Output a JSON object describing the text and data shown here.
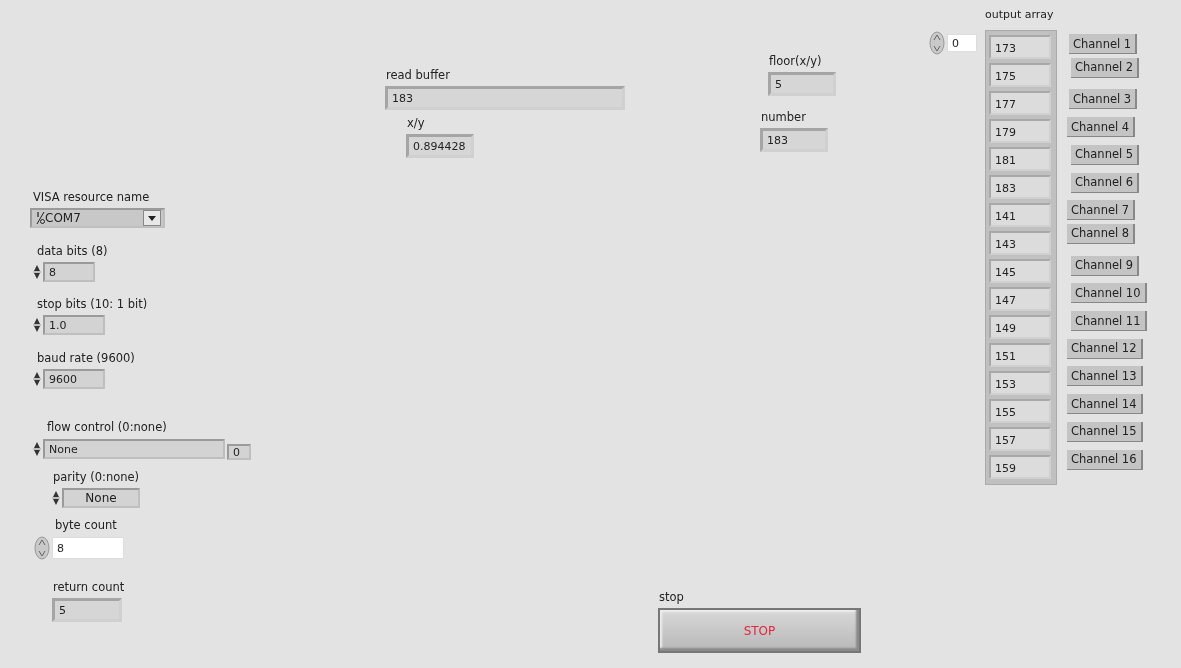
{
  "controls": [
    {
      "kind": "visa",
      "label": "VISA resource name",
      "value": "COM7"
    },
    {
      "kind": "numeric",
      "label": "data bits (8)",
      "value": "8"
    },
    {
      "kind": "numeric",
      "label": "stop bits (10: 1 bit)",
      "value": "1.0"
    },
    {
      "kind": "numeric",
      "label": "baud rate (9600)",
      "value": "9600"
    },
    {
      "kind": "enum",
      "label": "flow control (0:none)",
      "value": "None",
      "index": "0"
    },
    {
      "kind": "ring",
      "label": "parity (0:none)",
      "value": "None"
    },
    {
      "kind": "input",
      "label": "byte count",
      "value": "8"
    },
    {
      "kind": "indicator",
      "label": "return count",
      "value": "5"
    },
    {
      "kind": "indicator",
      "label": "read buffer",
      "value": "183"
    },
    {
      "kind": "indicator",
      "label": "x/y",
      "value": "0.894428"
    },
    {
      "kind": "indicator",
      "label": "floor(x/y)",
      "value": "5"
    },
    {
      "kind": "indicator",
      "label": "number",
      "value": "183"
    },
    {
      "kind": "button",
      "label": "stop",
      "value": "STOP"
    }
  ],
  "output_array": {
    "label": "output array",
    "index": "0",
    "values": [
      "173",
      "175",
      "177",
      "179",
      "181",
      "183",
      "141",
      "143",
      "145",
      "147",
      "149",
      "151",
      "153",
      "155",
      "157",
      "159"
    ]
  },
  "channels": [
    "Channel 1",
    "Channel 2",
    "Channel 3",
    "Channel 4",
    "Channel 5",
    "Channel 6",
    "Channel 7",
    "Channel 8",
    "Channel 9",
    "Channel 10",
    "Channel 11",
    "Channel 12",
    "Channel 13",
    "Channel 14",
    "Channel 15",
    "Channel 16"
  ]
}
